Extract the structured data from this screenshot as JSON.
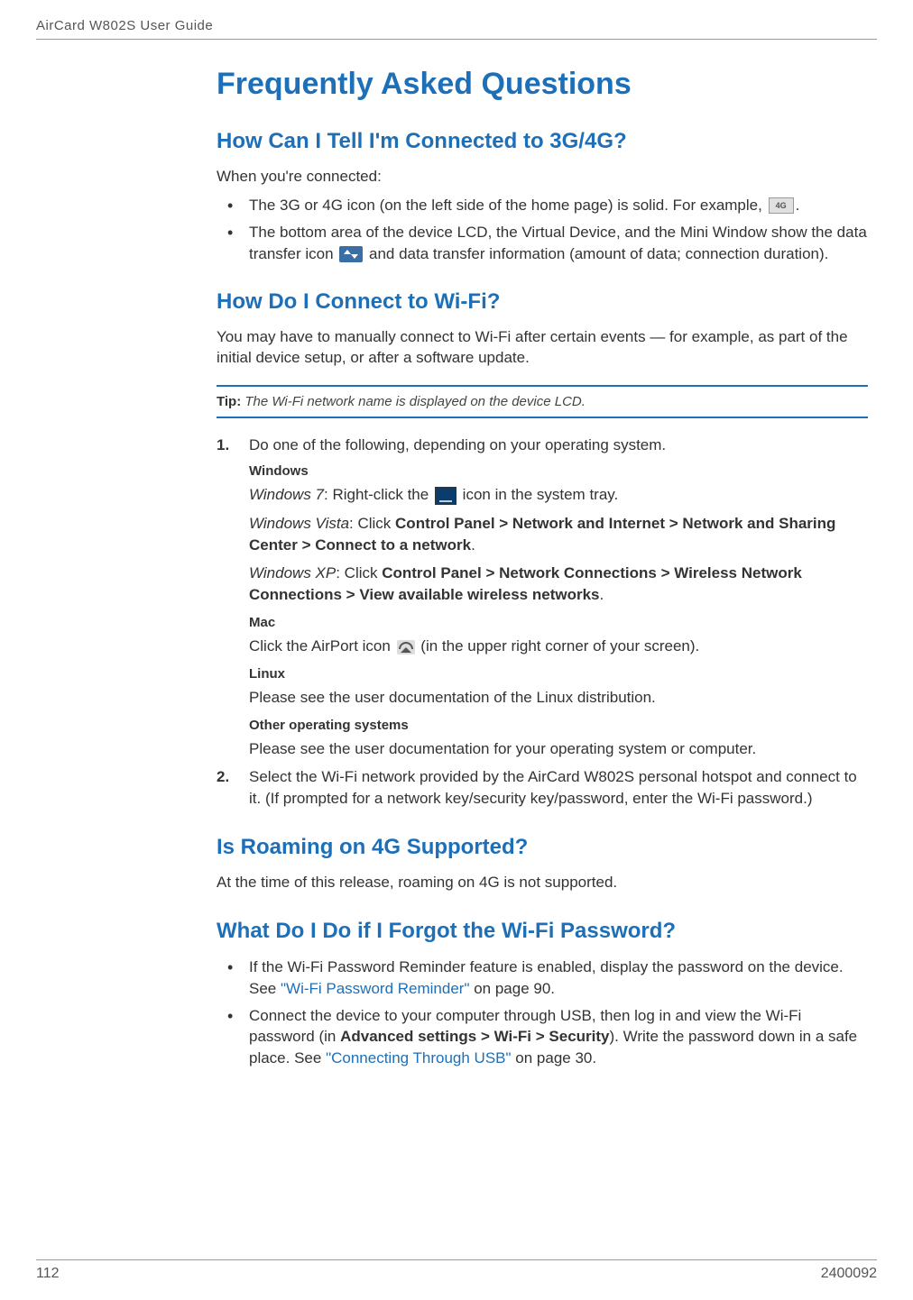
{
  "header": {
    "doc_title": "AirCard W802S User Guide"
  },
  "title": "Frequently Asked Questions",
  "sections": {
    "s1": {
      "heading": "How Can I Tell I'm Connected to 3G/4G?",
      "intro": "When you're connected:",
      "bullet1_a": "The 3G or 4G icon (on the left side of the home page) is solid. For example, ",
      "bullet1_b": ".",
      "bullet2_a": "The bottom area of the device LCD, the Virtual Device, and the Mini Window show the data transfer icon ",
      "bullet2_b": " and data transfer information (amount of data; connection duration)."
    },
    "s2": {
      "heading": "How Do I Connect to Wi-Fi?",
      "intro": "You may have to manually connect to Wi-Fi after certain events — for example, as part of the initial device setup, or after a software update.",
      "tip_label": "Tip:",
      "tip_text": " The Wi-Fi network name is displayed on the device LCD.",
      "step1_num": "1.",
      "step1_text": " Do one of the following, depending on your operating system.",
      "windows_label": "Windows",
      "win7_os": "Windows 7",
      "win7_a": ": Right-click the ",
      "win7_b": " icon in the system tray.",
      "vista_os": "Windows Vista",
      "vista_a": ": Click ",
      "vista_path": "Control Panel > Network and Internet > Network and Sharing Center > Connect to a network",
      "vista_b": ".",
      "xp_os": "Windows XP",
      "xp_a": ": Click ",
      "xp_path": "Control Panel > Network Connections > Wireless Network Connections > View available wireless networks",
      "xp_b": ".",
      "mac_label": "Mac",
      "mac_a": "Click the AirPort icon ",
      "mac_b": " (in the upper right corner of your screen).",
      "linux_label": "Linux",
      "linux_text": "Please see the user documentation of the Linux distribution.",
      "other_label": "Other operating systems",
      "other_text": "Please see the user documentation for your operating system or computer.",
      "step2_num": "2.",
      "step2_text": "Select the Wi-Fi network provided by the AirCard W802S personal hotspot and connect to it. (If prompted for a network key/security key/password, enter the Wi-Fi password.)"
    },
    "s3": {
      "heading": "Is Roaming on 4G Supported?",
      "text": "At the time of this release, roaming on 4G is not supported."
    },
    "s4": {
      "heading": "What Do I Do if I Forgot the Wi-Fi Password?",
      "bullet1_a": "If the Wi-Fi Password Reminder feature is enabled, display the password on the device. See ",
      "bullet1_link": "\"Wi-Fi Password Reminder\"",
      "bullet1_b": " on page 90.",
      "bullet2_a": "Connect the device to your computer through USB, then log in and view the Wi-Fi password (in ",
      "bullet2_path": "Advanced settings > Wi-Fi > Security",
      "bullet2_b": "). Write the password down in a safe place. See ",
      "bullet2_link": "\"Connecting Through USB\"",
      "bullet2_c": " on page 30."
    }
  },
  "icons": {
    "icon_4g_label": "4G"
  },
  "footer": {
    "page_number": "112",
    "doc_number": "2400092"
  }
}
